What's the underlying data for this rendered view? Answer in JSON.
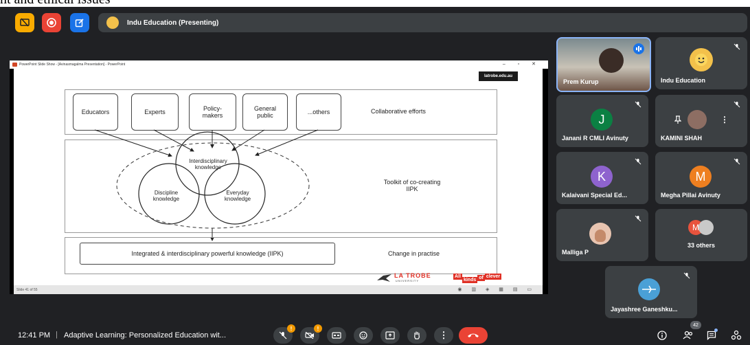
{
  "top_caption": "nt and ethical issues",
  "presenting_label": "Indu Education (Presenting)",
  "ppt": {
    "window_title": "PowerPoint Slide Show - [Avinasmagalma Presentation] - PowerPoint",
    "slide_counter": "Slide 41 of 55"
  },
  "slide": {
    "url": "latrobe.edu.au",
    "boxes": [
      "Educators",
      "Experts",
      "Policy-\nmakers",
      "General\npublic",
      "...others"
    ],
    "label_collab": "Collaborative efforts",
    "venn_top": "Interdisciplinary\nknowledge",
    "venn_left": "Discipline\nknowledge",
    "venn_right": "Everyday\nknowledge",
    "label_toolkit": "Toolkit of co-creating\nIIPK",
    "iipk": "Integrated & interdisciplinary powerful knowledge (IIPK)",
    "label_change": "Change in practise",
    "latrobe_name": "LA TROBE",
    "latrobe_sub": "UNIVERSITY",
    "tagline_1": "All",
    "tagline_2": "kinds",
    "tagline_3": "of",
    "tagline_4": "clever"
  },
  "participants": [
    {
      "name": "Prem Kurup",
      "initial": "",
      "color": "#6d6d6d"
    },
    {
      "name": "Indu Education",
      "initial": "",
      "color": "#f3c14b"
    },
    {
      "name": "Janani R CMLI Avinuty",
      "initial": "J",
      "color": "#0b8043"
    },
    {
      "name": "KAMINI SHAH",
      "initial": "",
      "color": "#8d6e63"
    },
    {
      "name": "Kalaivani Special Ed...",
      "initial": "K",
      "color": "#8e63ce"
    },
    {
      "name": "Megha Pillai Avinuty",
      "initial": "M",
      "color": "#ee7f20"
    },
    {
      "name": "Malliga P",
      "initial": "",
      "color": "#e8c4b0"
    },
    {
      "name": "33 others",
      "initial": "M",
      "color": "#e8533d"
    },
    {
      "name": "Jayashree Ganeshku...",
      "initial": "",
      "color": "#4aa0d6"
    }
  ],
  "footer": {
    "time": "12:41 PM",
    "separator": "|",
    "meeting_title": "Adaptive Learning: Personalized Education wit...",
    "people_count": "42",
    "badge_mark": "!"
  },
  "colors": {
    "end_call": "#ea4335",
    "accent_blue": "#1a73e8",
    "warning": "#f29900"
  }
}
